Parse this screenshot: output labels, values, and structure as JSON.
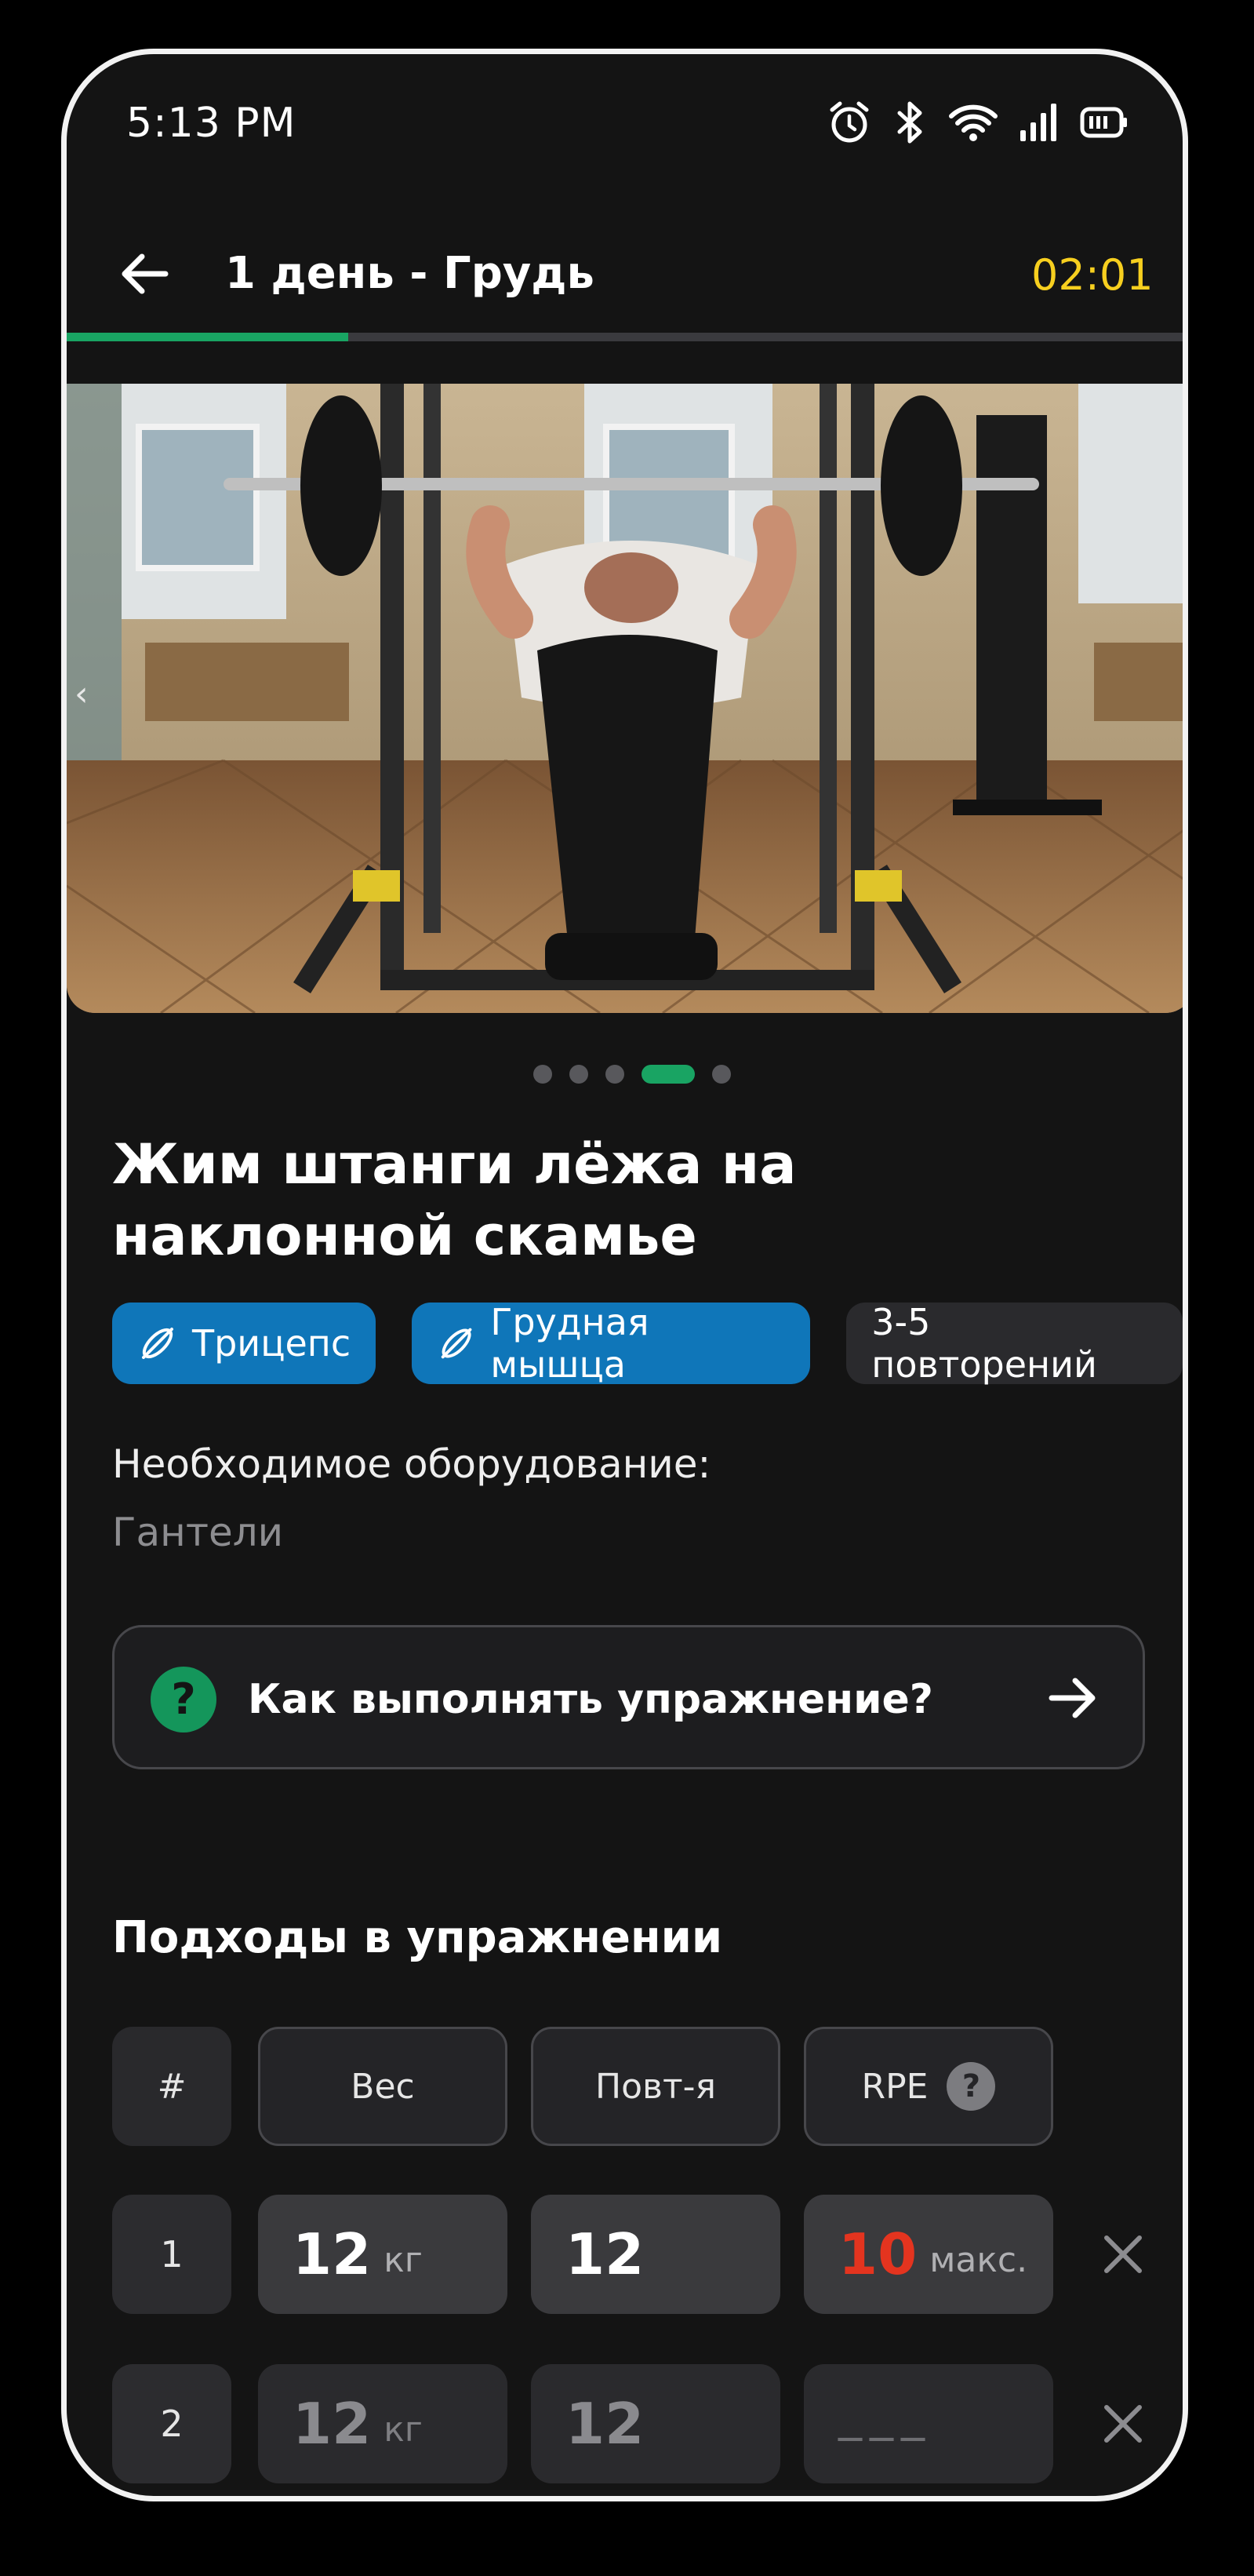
{
  "status_bar": {
    "time": "5:13 PM"
  },
  "header": {
    "title": "1 день - Грудь",
    "timer": "02:01",
    "progress": 0.25
  },
  "media": {
    "slide_count": 5,
    "active_slide": 4
  },
  "exercise": {
    "name": "Жим штанги лёжа на наклонной скамье",
    "tags": [
      "Трицепс",
      "Грудная мышца",
      "3-5 повторений"
    ],
    "equipment_label": "Необходимое оборудование:",
    "equipment_value": "Гантели",
    "how_to_label": "Как выполнять упражнение?",
    "how_to_icon": "?"
  },
  "sets": {
    "title": "Подходы в упражнении",
    "columns": {
      "num": "#",
      "weight": "Вес",
      "reps": "Повт-я",
      "rpe": "RPE",
      "rpe_help": "?"
    },
    "rows": [
      {
        "num": "1",
        "weight": "12",
        "weight_unit": "кг",
        "reps": "12",
        "rpe": "10",
        "rpe_note": "макс."
      },
      {
        "num": "2",
        "weight": "12",
        "weight_unit": "кг",
        "reps": "12",
        "rpe_placeholder": "___"
      }
    ]
  },
  "colors": {
    "accent": "#19a463",
    "timer": "#f7cf1f",
    "tag": "#0f76b9",
    "rpe_max": "#e4341f"
  }
}
